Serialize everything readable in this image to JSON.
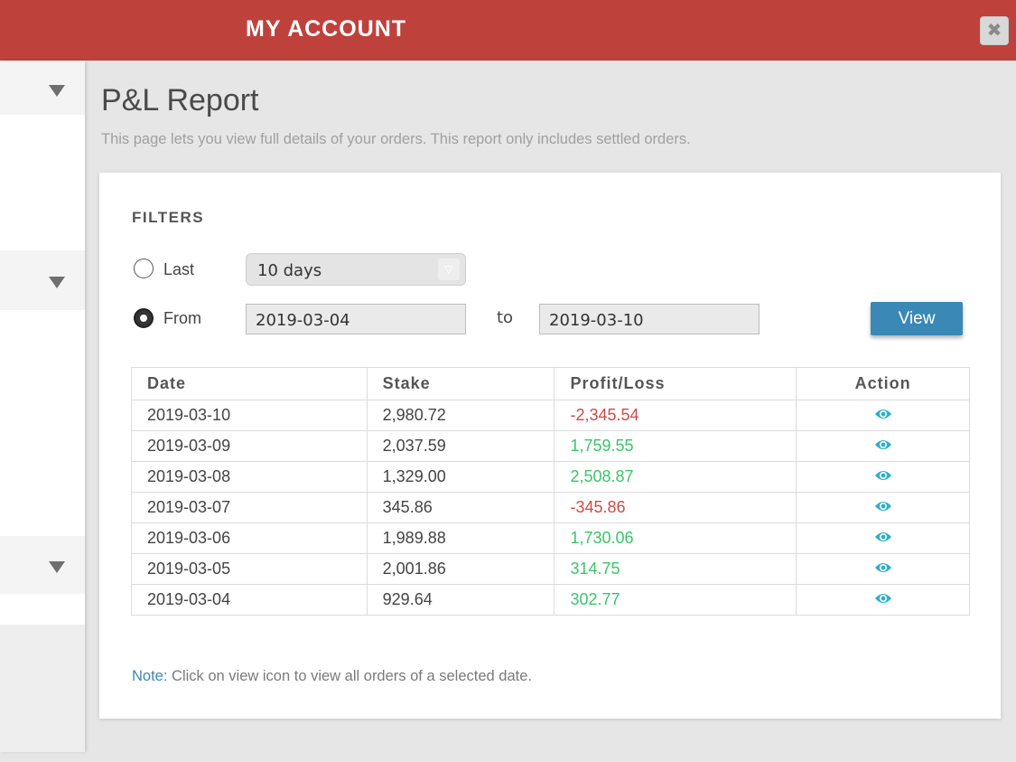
{
  "header": {
    "title": "MY ACCOUNT",
    "close_icon": "close-icon"
  },
  "page": {
    "title": "P&L Report",
    "description": "This page lets you view full details of your orders. This report only includes settled orders."
  },
  "filters": {
    "label": "FILTERS",
    "last_label": "Last",
    "last_selected": false,
    "period_value": "10 days",
    "from_label": "From",
    "from_selected": true,
    "from_date": "2019-03-04",
    "to_label": "to",
    "to_date": "2019-03-10",
    "view_label": "View"
  },
  "table": {
    "headers": [
      "Date",
      "Stake",
      "Profit/Loss",
      "Action"
    ],
    "action_icon": "eye-icon",
    "rows": [
      {
        "date": "2019-03-10",
        "stake": "2,980.72",
        "pl": "-2,345.54",
        "status": "loss"
      },
      {
        "date": "2019-03-09",
        "stake": "2,037.59",
        "pl": "1,759.55",
        "status": "profit"
      },
      {
        "date": "2019-03-08",
        "stake": "1,329.00",
        "pl": "2,508.87",
        "status": "profit"
      },
      {
        "date": "2019-03-07",
        "stake": "345.86",
        "pl": "-345.86",
        "status": "loss"
      },
      {
        "date": "2019-03-06",
        "stake": "1,989.88",
        "pl": "1,730.06",
        "status": "profit"
      },
      {
        "date": "2019-03-05",
        "stake": "2,001.86",
        "pl": "314.75",
        "status": "profit"
      },
      {
        "date": "2019-03-04",
        "stake": "929.64",
        "pl": "302.77",
        "status": "profit"
      }
    ]
  },
  "note": {
    "label": "Note:",
    "text": " Click on view icon to view all orders of a selected date."
  },
  "sidebar": {
    "toggle_icon": "triangle-down-icon"
  },
  "colors": {
    "header_bg": "#bf413c",
    "accent": "#3a88b5",
    "profit": "#3cc46a",
    "loss": "#cf4a45",
    "eye": "#2ab0c9"
  }
}
